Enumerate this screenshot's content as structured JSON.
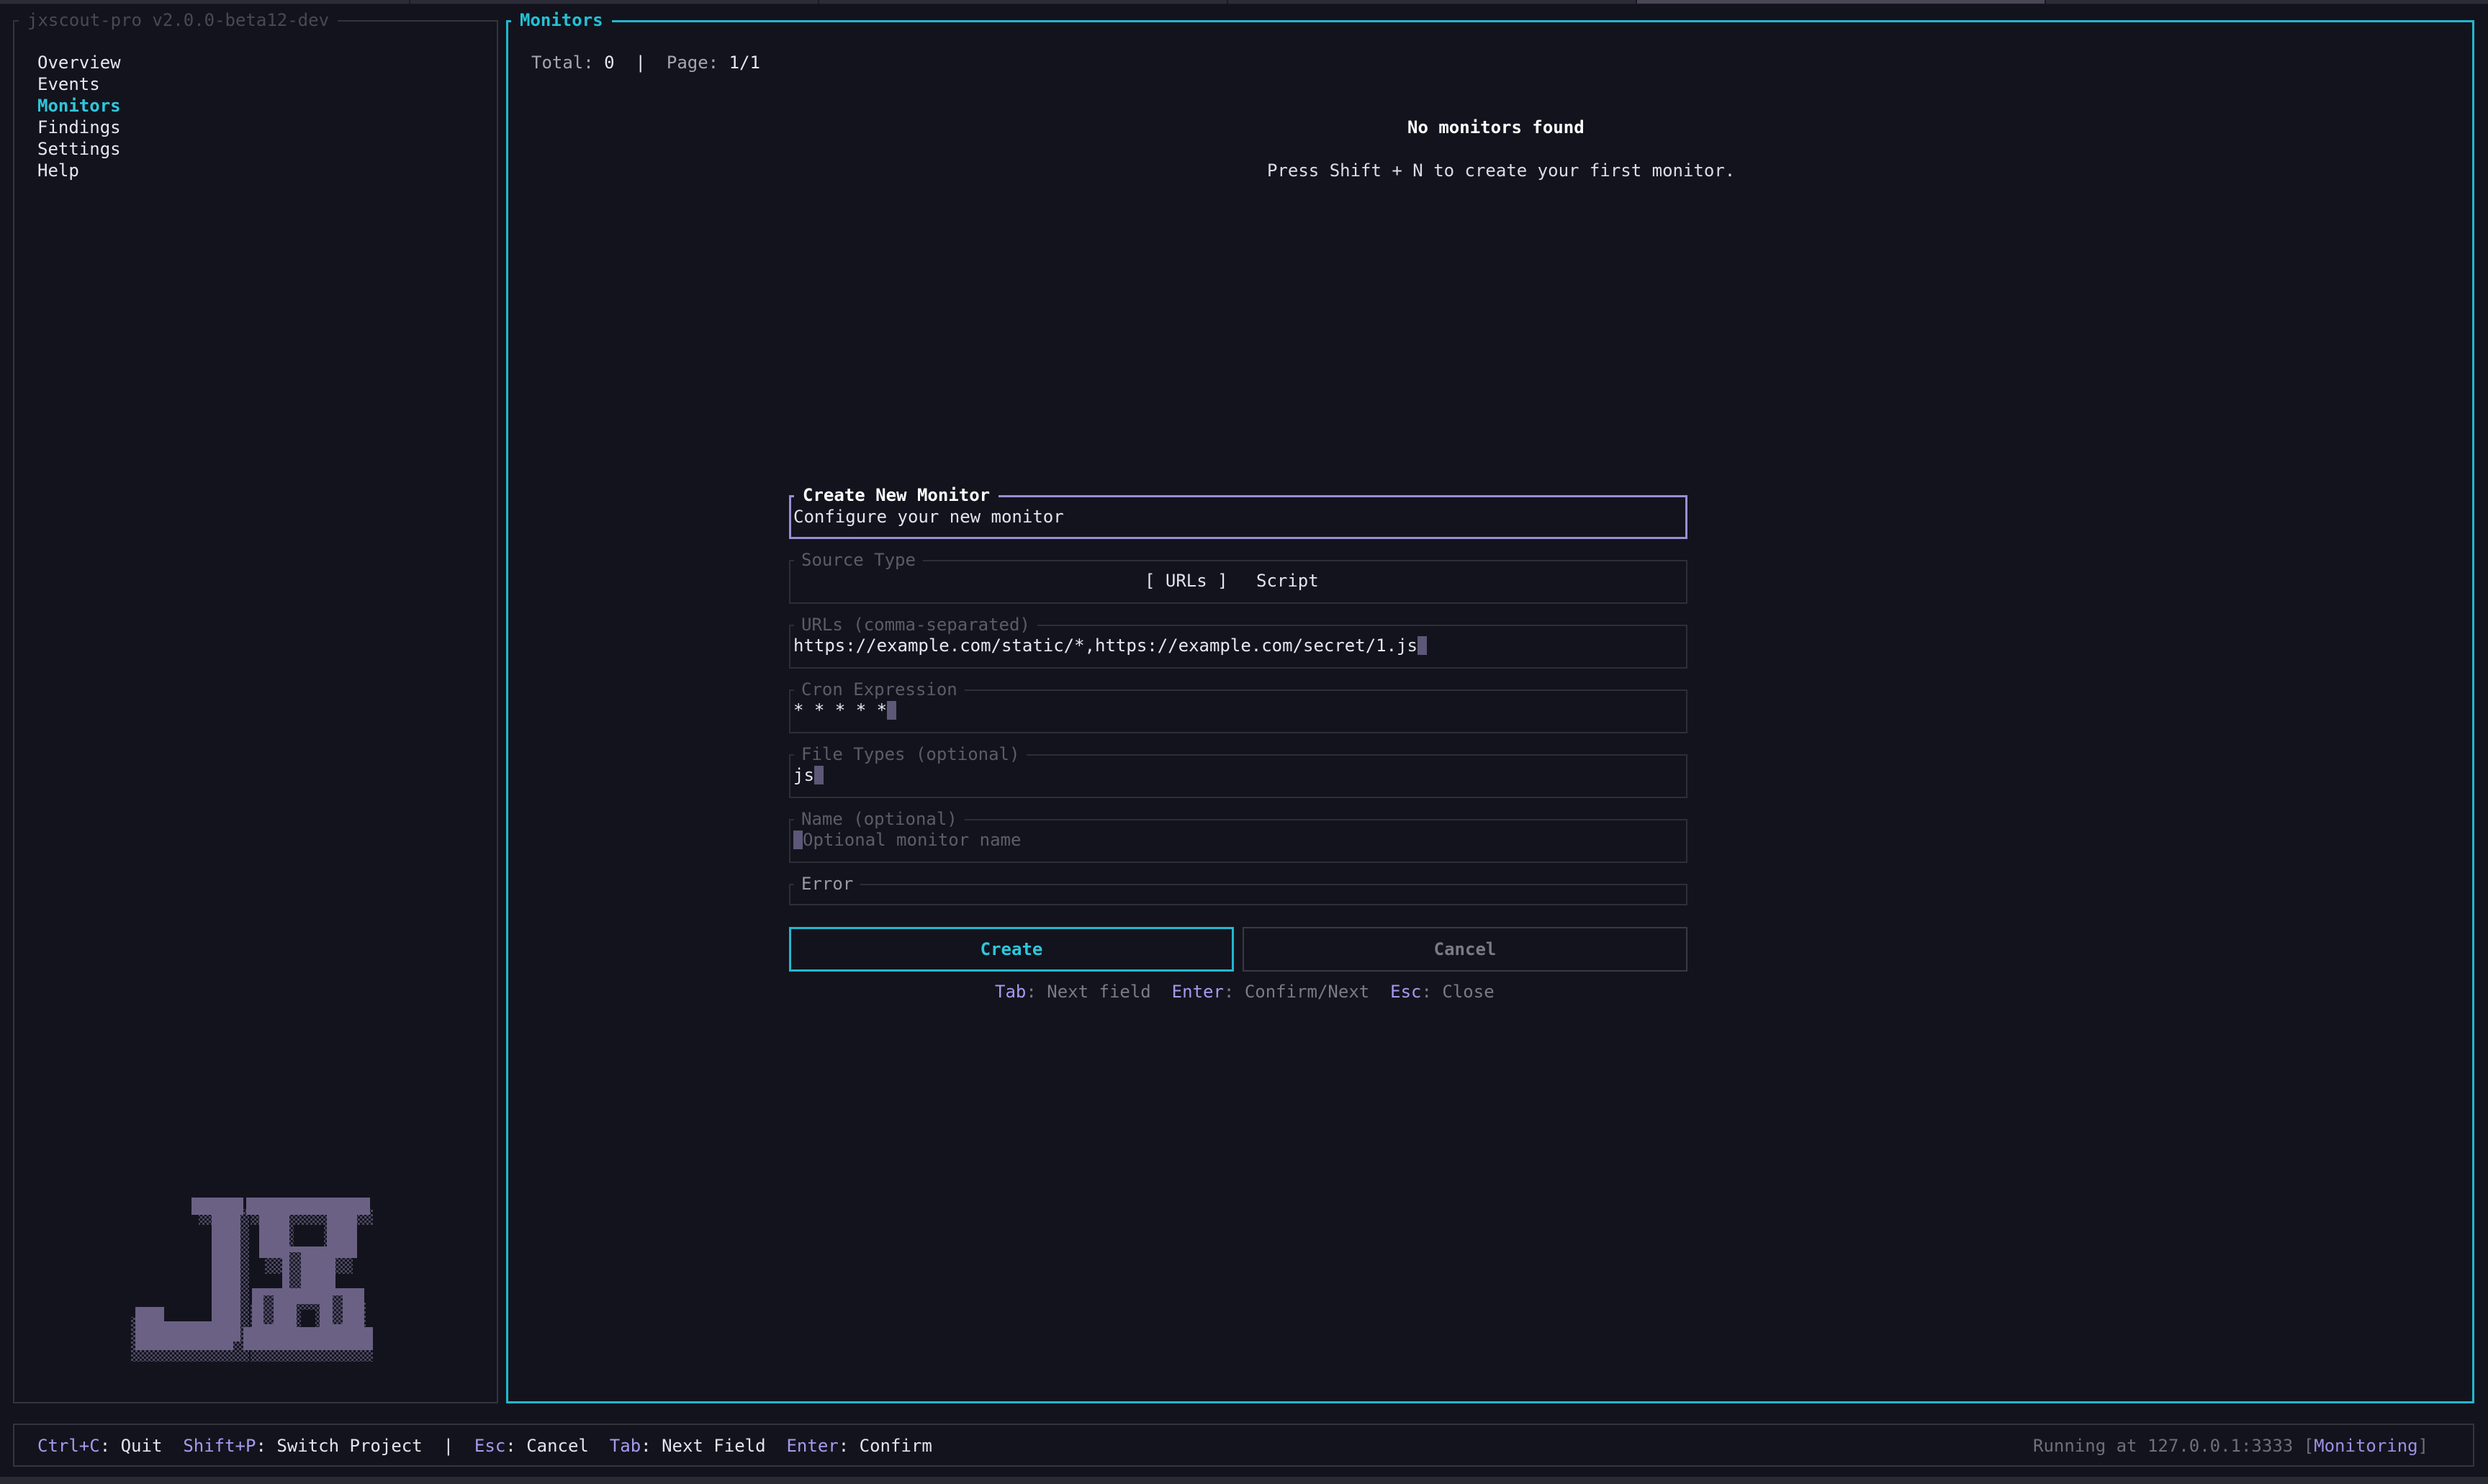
{
  "app": {
    "title": "jxscout-pro v2.0.0-beta12-dev"
  },
  "sidebar": {
    "items": [
      {
        "label": "Overview",
        "active": false
      },
      {
        "label": "Events",
        "active": false
      },
      {
        "label": "Monitors",
        "active": true
      },
      {
        "label": "Findings",
        "active": false
      },
      {
        "label": "Settings",
        "active": false
      },
      {
        "label": "Help",
        "active": false
      }
    ],
    "logo_text": "JX"
  },
  "main": {
    "title": "Monitors",
    "total_label": "Total:",
    "total_value": "0",
    "separator": "|",
    "page_label": "Page:",
    "page_value": "1/1",
    "empty_title": "No monitors found",
    "empty_hint": "Press Shift + N to create your first monitor."
  },
  "modal": {
    "title": "Create New Monitor",
    "subtitle": "Configure your new monitor",
    "source_type": {
      "label": "Source Type",
      "options": [
        "[ URLs ]",
        "Script"
      ],
      "selected": "URLs"
    },
    "urls": {
      "label": "URLs (comma-separated)",
      "value": "https://example.com/static/*,https://example.com/secret/1.js"
    },
    "cron": {
      "label": "Cron Expression",
      "value": "* * * * *"
    },
    "file_types": {
      "label": "File Types (optional)",
      "value": "js"
    },
    "name": {
      "label": "Name (optional)",
      "value": "",
      "placeholder": "Optional monitor name"
    },
    "error": {
      "label": "Error",
      "value": ""
    },
    "create_label": "Create",
    "cancel_label": "Cancel",
    "hints": [
      {
        "key": "Tab",
        "desc": "Next field"
      },
      {
        "key": "Enter",
        "desc": "Confirm/Next"
      },
      {
        "key": "Esc",
        "desc": "Close"
      }
    ]
  },
  "statusbar": {
    "shortcuts": [
      {
        "key": "Ctrl+C",
        "desc": "Quit"
      },
      {
        "key": "Shift+P",
        "desc": "Switch Project"
      },
      {
        "key": "Esc",
        "desc": "Cancel"
      },
      {
        "key": "Tab",
        "desc": "Next Field"
      },
      {
        "key": "Enter",
        "desc": "Confirm"
      }
    ],
    "running_text": "Running at 127.0.0.1:3333",
    "mode_label": "Monitoring"
  },
  "colors": {
    "accent": "#22b8cf",
    "modal_border": "#9a8ed3",
    "key_hint": "#a899ee",
    "background": "#13131d"
  }
}
